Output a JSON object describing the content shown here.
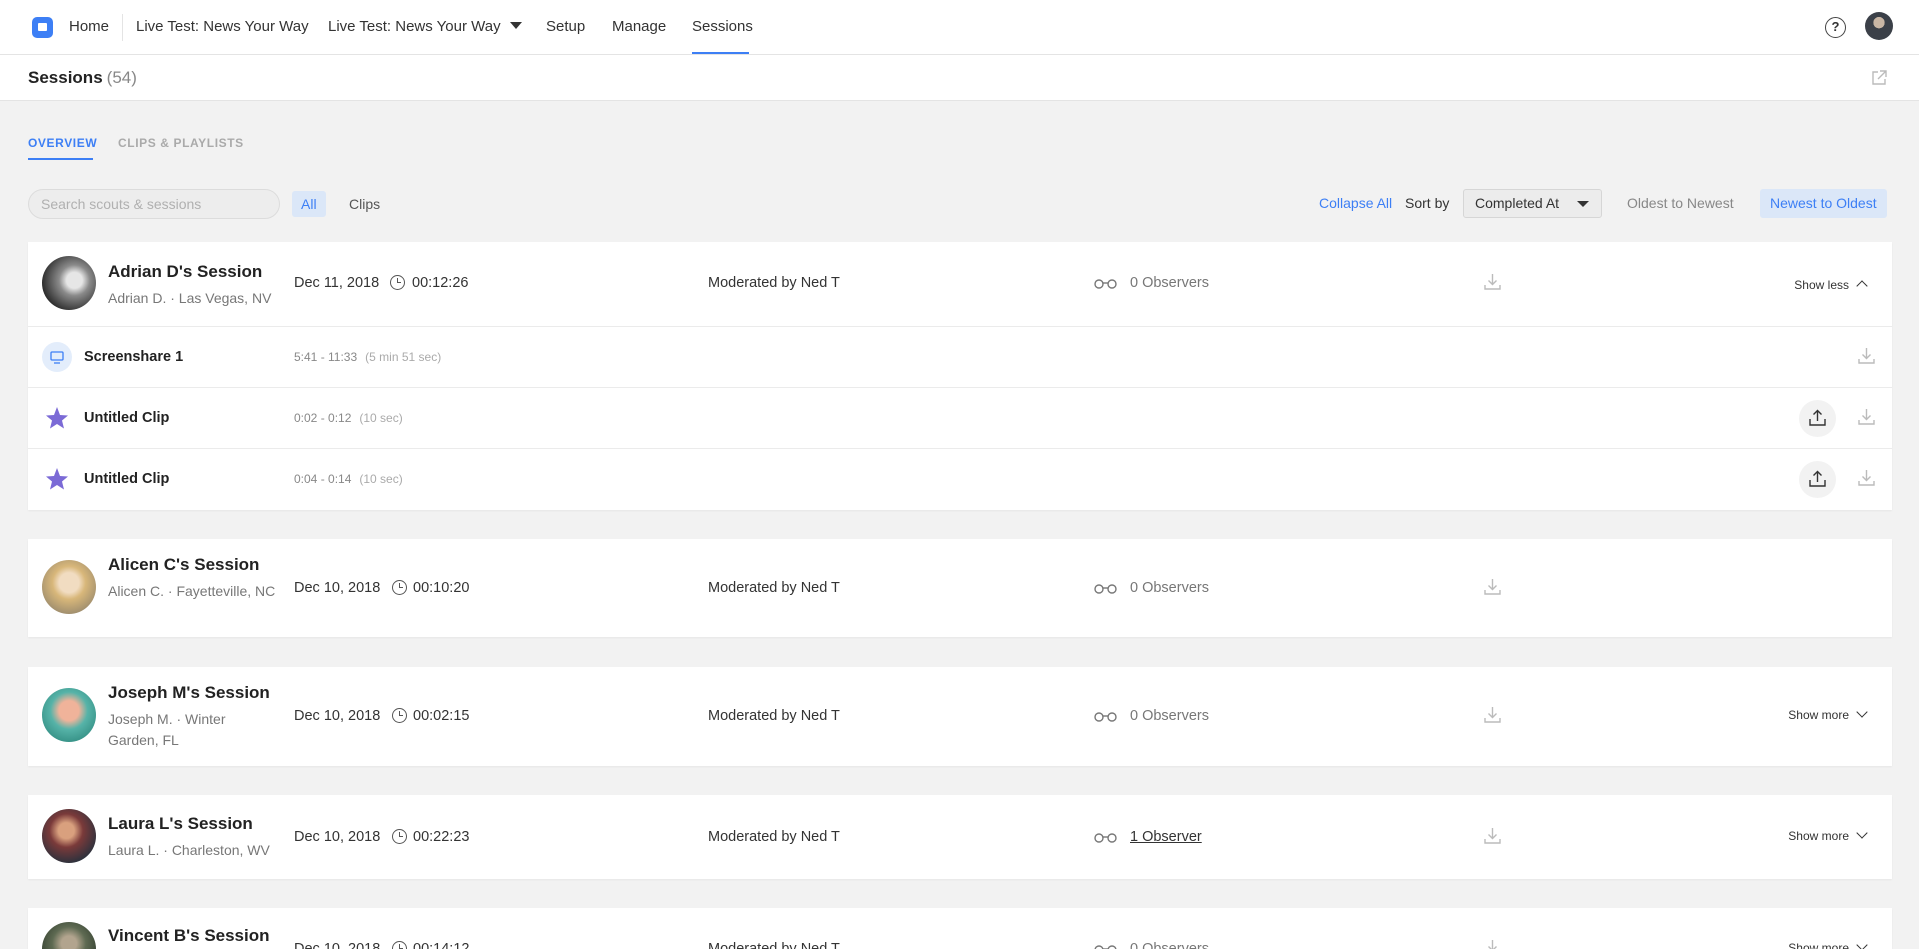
{
  "nav": {
    "home": "Home",
    "project_link": "Live Test: News Your Way",
    "project_dropdown": "Live Test: News Your Way",
    "setup": "Setup",
    "manage": "Manage",
    "sessions": "Sessions",
    "help_glyph": "?"
  },
  "header": {
    "title": "Sessions",
    "count": "(54)"
  },
  "tabs": {
    "overview": "OVERVIEW",
    "clips": "CLIPS & PLAYLISTS"
  },
  "filters": {
    "search_placeholder": "Search scouts & sessions",
    "all": "All",
    "clips": "Clips",
    "collapse_all": "Collapse All",
    "sort_by": "Sort by",
    "sort_value": "Completed At",
    "oldest": "Oldest to Newest",
    "newest": "Newest to Oldest"
  },
  "sessions": [
    {
      "title": "Adrian D's Session",
      "subtitle": "Adrian D. · Las Vegas, NV",
      "date": "Dec 11, 2018",
      "duration": "00:12:26",
      "moderator": "Moderated by Ned T",
      "observers": "0 Observers",
      "toggle": "Show less",
      "subrows": [
        {
          "name": "Screenshare 1",
          "time": "5:41 - 11:33",
          "length": "(5 min 51 sec)"
        },
        {
          "name": "Untitled Clip",
          "time": "0:02 - 0:12",
          "length": "(10 sec)"
        },
        {
          "name": "Untitled Clip",
          "time": "0:04 - 0:14",
          "length": "(10 sec)"
        }
      ]
    },
    {
      "title": "Alicen C's Session",
      "subtitle": "Alicen C. · Fayetteville, NC",
      "date": "Dec 10, 2018",
      "duration": "00:10:20",
      "moderator": "Moderated by Ned T",
      "observers": "0 Observers"
    },
    {
      "title": "Joseph M's Session",
      "subtitle": "Joseph M. · Winter Garden, FL",
      "date": "Dec 10, 2018",
      "duration": "00:02:15",
      "moderator": "Moderated by Ned T",
      "observers": "0 Observers",
      "toggle": "Show more"
    },
    {
      "title": "Laura L's Session",
      "subtitle": "Laura L. · Charleston, WV",
      "date": "Dec 10, 2018",
      "duration": "00:22:23",
      "moderator": "Moderated by Ned T",
      "observers": "1 Observer",
      "toggle": "Show more"
    },
    {
      "title": "Vincent B's Session",
      "date": "Dec 10, 2018",
      "duration": "00:14:12",
      "moderator": "Moderated by Ned T",
      "observers": "0 Observers",
      "toggle": "Show more"
    }
  ],
  "colors": {
    "accent": "#3d7ff5",
    "star": "#7b6ad6",
    "chip_bg": "#dbe7f8"
  },
  "icons": [
    "logo-icon",
    "caret-down-icon",
    "help-icon",
    "share-icon",
    "clock-icon",
    "glasses-icon",
    "download-icon",
    "monitor-icon",
    "star-icon",
    "upload-icon",
    "chevron-up-icon",
    "chevron-down-icon"
  ]
}
